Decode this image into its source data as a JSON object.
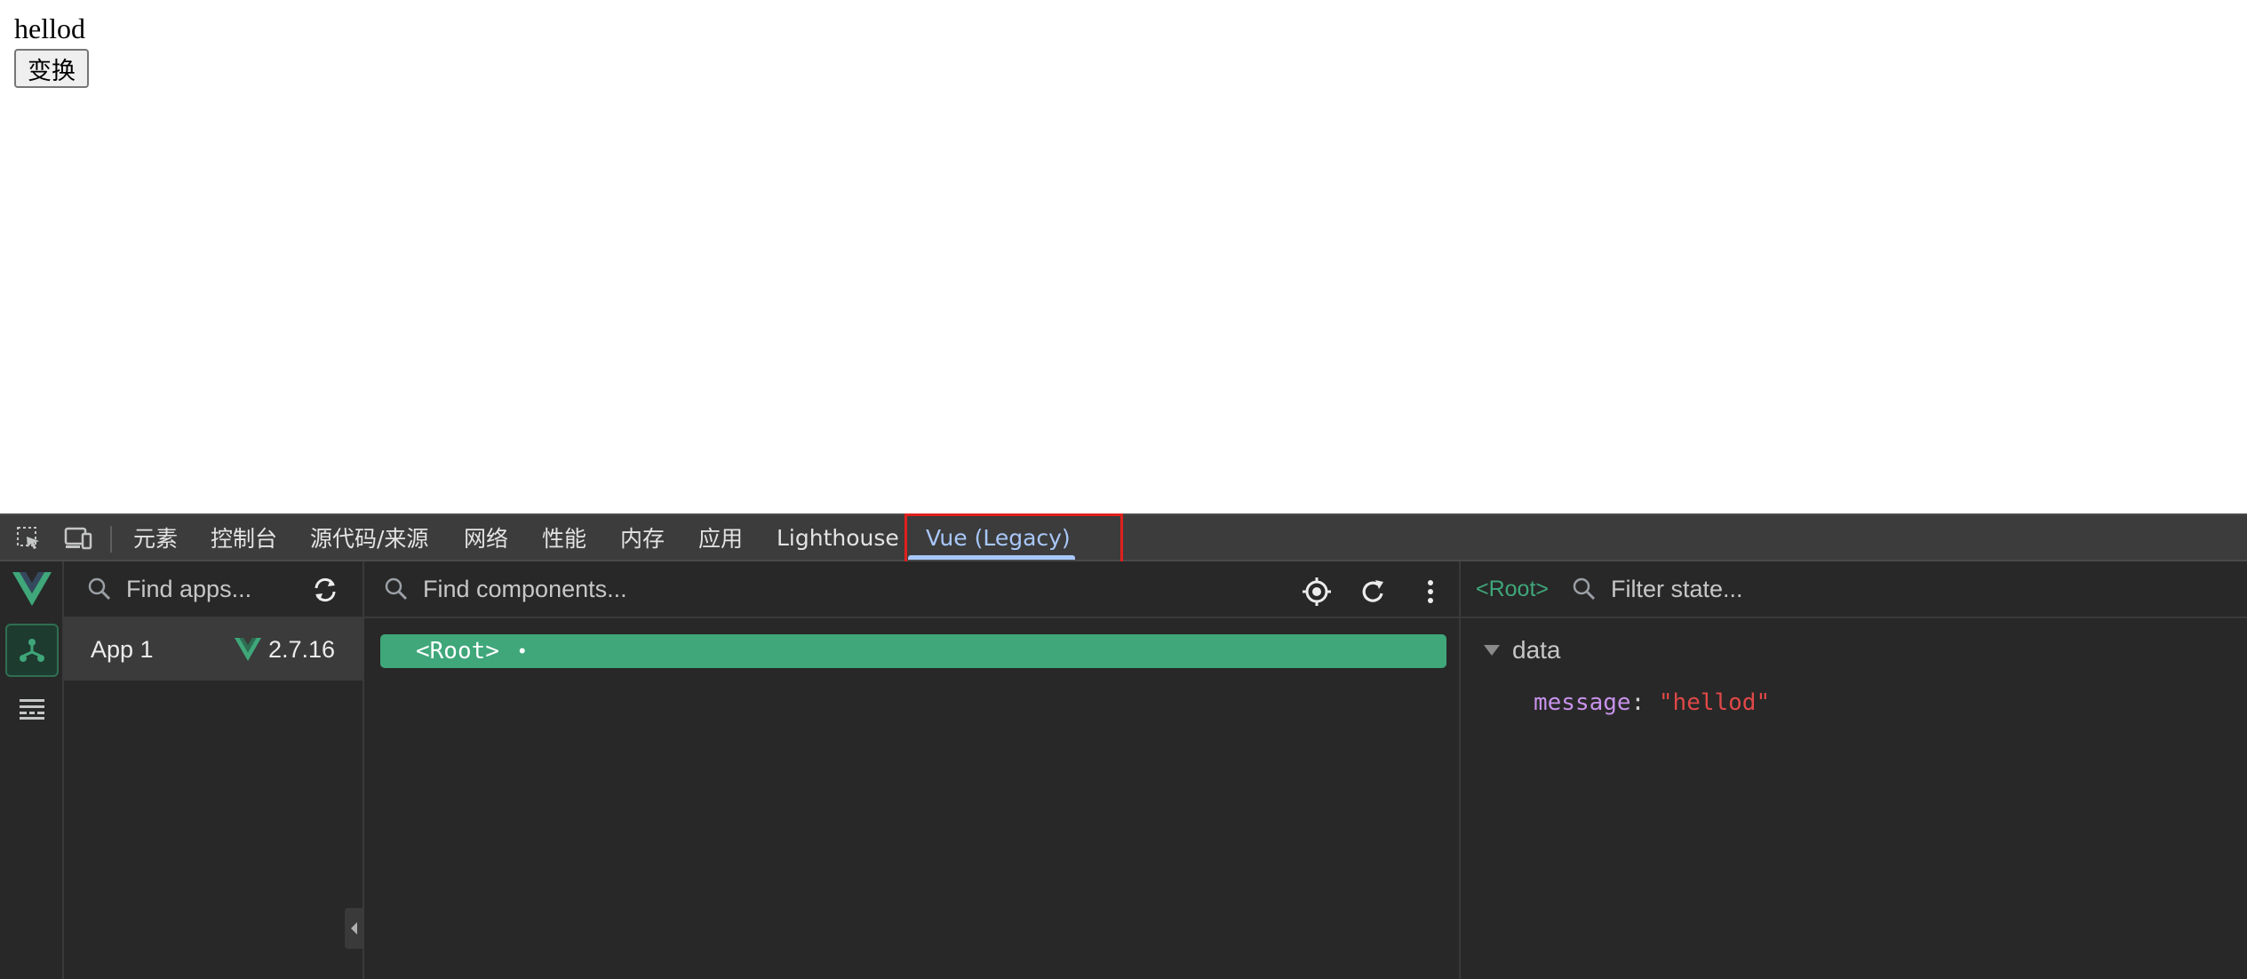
{
  "page": {
    "text": "hellod",
    "button_label": "变换"
  },
  "devtools": {
    "tabs": [
      {
        "label": "元素"
      },
      {
        "label": "控制台"
      },
      {
        "label": "源代码/来源"
      },
      {
        "label": "网络"
      },
      {
        "label": "性能"
      },
      {
        "label": "内存"
      },
      {
        "label": "应用"
      },
      {
        "label": "Lighthouse"
      },
      {
        "label": "Vue (Legacy)",
        "active": true
      }
    ],
    "toolbar_icons": [
      "inspect-element-icon",
      "device-toolbar-icon"
    ]
  },
  "vue": {
    "rail_icons": [
      "vue-logo-icon",
      "components-tree-icon",
      "timeline-icon"
    ],
    "apps": {
      "search_placeholder": "Find apps...",
      "items": [
        {
          "name": "App 1",
          "version": "2.7.16"
        }
      ]
    },
    "components": {
      "search_placeholder": "Find components...",
      "tree": [
        {
          "label": "<Root>",
          "marker": "•",
          "selected": true
        }
      ]
    },
    "state": {
      "component": "<Root>",
      "search_placeholder": "Filter state...",
      "section": "data",
      "props": [
        {
          "key": "message",
          "value": "\"hellod\""
        }
      ]
    }
  },
  "colors": {
    "vue_green": "#3fa77a",
    "highlight": "#e0201c",
    "active_tab": "#a8c7fa",
    "string_value": "#e04848",
    "key_purple": "#c792ea"
  }
}
